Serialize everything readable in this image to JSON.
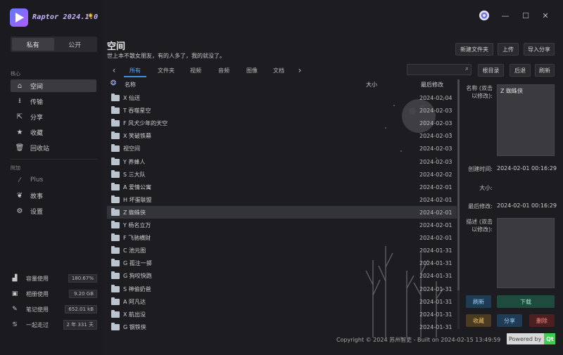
{
  "app": {
    "title": "Raptor 2024.1.0"
  },
  "scope_toggle": {
    "private_label": "私有",
    "public_label": "公开"
  },
  "sidebar": {
    "section_core": "核心",
    "core_items": [
      {
        "label": "空间",
        "icon": "home-icon"
      },
      {
        "label": "传输",
        "icon": "download-icon"
      },
      {
        "label": "分享",
        "icon": "share-icon"
      },
      {
        "label": "收藏",
        "icon": "star-icon"
      },
      {
        "label": "回收站",
        "icon": "trash-icon"
      }
    ],
    "section_misc": "附加",
    "misc_items": [
      {
        "label": "Plus",
        "icon": "wand-icon"
      },
      {
        "label": "故事",
        "icon": "leaf-icon"
      },
      {
        "label": "设置",
        "icon": "gear-icon"
      }
    ],
    "stats": [
      {
        "label": "容量使用",
        "value": "180.67%",
        "icon": "bar-chart-icon"
      },
      {
        "label": "相册使用",
        "value": "9.20 GB",
        "icon": "image-icon"
      },
      {
        "label": "笔记使用",
        "value": "652.01 kB",
        "icon": "pen-icon"
      },
      {
        "label": "一起走过",
        "value": "2 年 331 天",
        "icon": "couple-icon"
      }
    ]
  },
  "header": {
    "title": "空间",
    "subtitle": "世上本不散女朋友，有的人多了，我的就没了。",
    "new_folder": "新建文件夹",
    "upload": "上传",
    "import_share": "导入分享",
    "root": "根目录",
    "back": "后退",
    "refresh": "刷新",
    "search_placeholder": ""
  },
  "tabs": [
    "所有",
    "文件夹",
    "视频",
    "音频",
    "图像",
    "文档"
  ],
  "table": {
    "col_name": "名称",
    "col_size": "大小",
    "col_modified": "最后修改",
    "rows": [
      {
        "name": "X 仙送",
        "date": "2024-02-04"
      },
      {
        "name": "T 吞噬星空",
        "date": "2024-02-03"
      },
      {
        "name": "F 风犬少年的天空",
        "date": "2024-02-03"
      },
      {
        "name": "X 笑破铁幕",
        "date": "2024-02-03"
      },
      {
        "name": "视空间",
        "date": "2024-02-03"
      },
      {
        "name": "Y 养蜂人",
        "date": "2024-02-03"
      },
      {
        "name": "S 三大队",
        "date": "2024-02-02"
      },
      {
        "name": "A 爱情公寓",
        "date": "2024-02-01"
      },
      {
        "name": "H 坏蛋联盟",
        "date": "2024-02-01"
      },
      {
        "name": "Z 蜘蛛侠",
        "date": "2024-02-01"
      },
      {
        "name": "Y 杨名立万",
        "date": "2024-02-01"
      },
      {
        "name": "F 飞驰横财",
        "date": "2024-02-01"
      },
      {
        "name": "C 池元图",
        "date": "2024-01-31"
      },
      {
        "name": "G 孤注一掷",
        "date": "2024-01-31"
      },
      {
        "name": "G 狗咬快跑",
        "date": "2024-01-31"
      },
      {
        "name": "S 神偷奶爸",
        "date": "2024-01-31"
      },
      {
        "name": "A 阿凡达",
        "date": "2024-01-31"
      },
      {
        "name": "X 航出没",
        "date": "2024-01-31"
      },
      {
        "name": "G 钢铁侠",
        "date": "2024-01-31"
      }
    ]
  },
  "details": {
    "name_label": "名称 (双击以修改):",
    "name_value": "Z 蜘蛛侠",
    "created_label": "创建时间:",
    "created_value": "2024-02-01 00:16:29",
    "size_label": "大小:",
    "modified_label": "最后修改:",
    "modified_value": "2024-02-01 00:16:29",
    "desc_label": "描述 (双击以修改):",
    "btn_refresh": "刷新",
    "btn_download": "下载",
    "btn_favorite": "收藏",
    "btn_share": "分享",
    "btn_delete": "删除"
  },
  "footer": {
    "copyright": "Copyright © 2024 苏州智吏 - Built on 2024-02-15 13:49:59",
    "powered_by": "Powered by",
    "qt": "Qt"
  },
  "colors": {
    "accent": "#3c8ee8",
    "download": "#1f4b3f",
    "share": "#1f3c55",
    "delete": "#4c2020",
    "favorite": "#4a3a22"
  }
}
